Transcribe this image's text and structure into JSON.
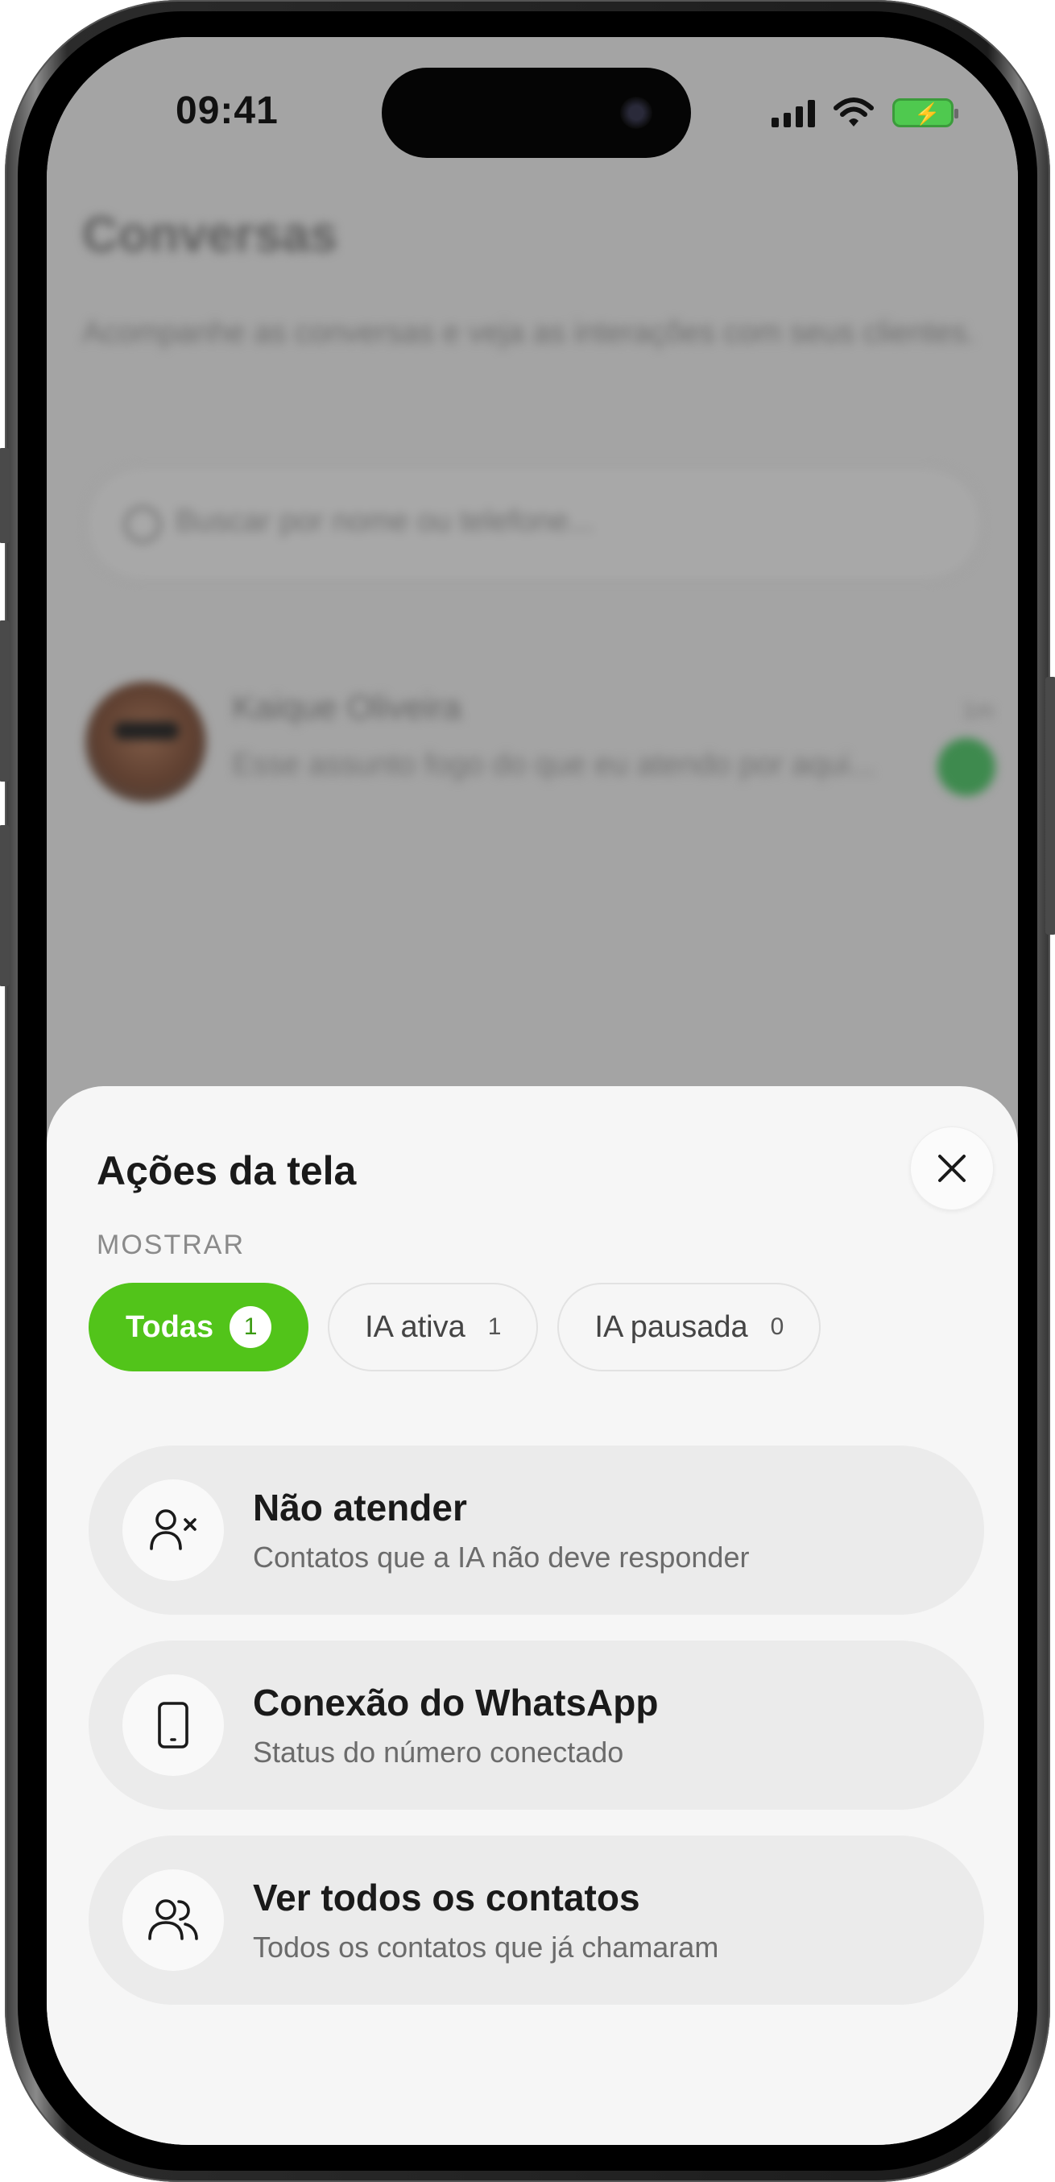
{
  "status_bar": {
    "time": "09:41"
  },
  "background": {
    "title": "Conversas",
    "subtitle": "Acompanhe as conversas e veja as interações com seus clientes.",
    "search_placeholder": "Buscar por nome ou telefone...",
    "conversation": {
      "name": "Kaique Oliveira",
      "preview": "Esse assunto fogo do que eu atendo por aqui...",
      "time": "1m"
    }
  },
  "sheet": {
    "title": "Ações da tela",
    "section_label": "MOSTRAR",
    "filters": [
      {
        "label": "Todas",
        "count": "1",
        "active": true
      },
      {
        "label": "IA ativa",
        "count": "1",
        "active": false
      },
      {
        "label": "IA pausada",
        "count": "0",
        "active": false
      }
    ],
    "actions": [
      {
        "icon": "user-x-icon",
        "title": "Não atender",
        "description": "Contatos que a IA não deve responder"
      },
      {
        "icon": "smartphone-icon",
        "title": "Conexão do WhatsApp",
        "description": "Status do número conectado"
      },
      {
        "icon": "users-icon",
        "title": "Ver todos os contatos",
        "description": "Todos os contatos que já chamaram"
      }
    ]
  },
  "colors": {
    "accent": "#52c41a",
    "sheet_bg": "#f6f6f6",
    "overlay": "#a4a4a4"
  }
}
